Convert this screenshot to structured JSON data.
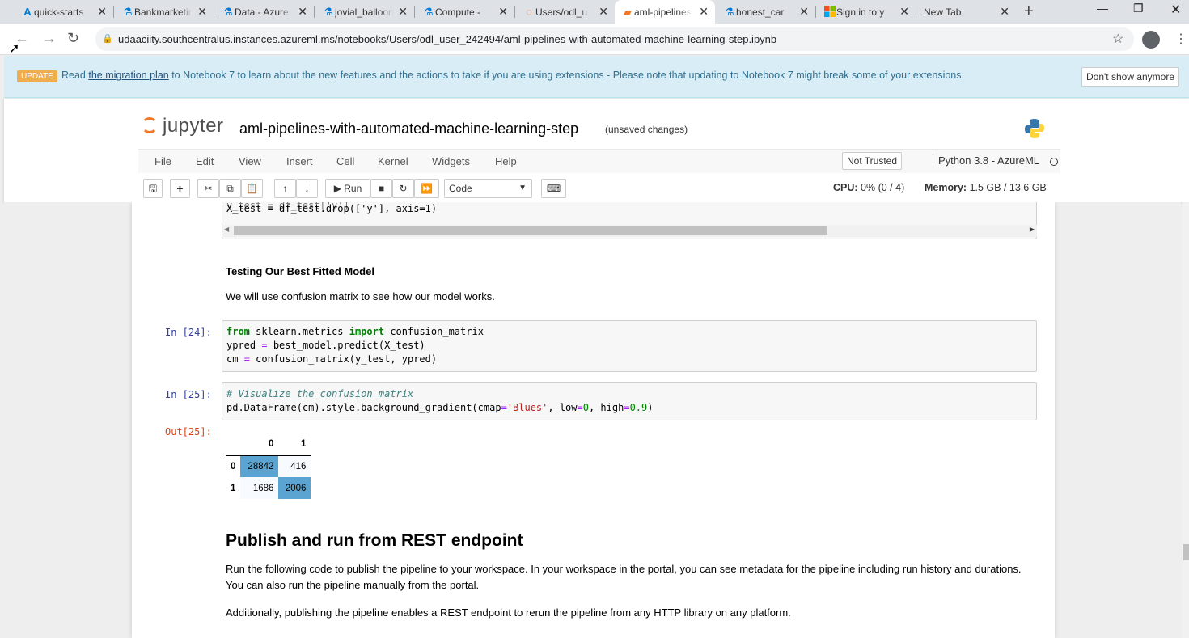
{
  "browser": {
    "tabs": [
      {
        "label": "quick-starts",
        "icon": "azure-icon"
      },
      {
        "label": "Bankmarketing",
        "icon": "azureml-icon"
      },
      {
        "label": "Data - Azure",
        "icon": "azureml-icon"
      },
      {
        "label": "jovial_balloon",
        "icon": "azureml-icon"
      },
      {
        "label": "Compute - ",
        "icon": "azureml-icon"
      },
      {
        "label": "Users/odl_u",
        "icon": "jupyter-icon"
      },
      {
        "label": "aml-pipelines",
        "icon": "notebook-icon"
      },
      {
        "label": "honest_car",
        "icon": "azureml-icon"
      },
      {
        "label": "Sign in to y",
        "icon": "microsoft-icon"
      },
      {
        "label": "New Tab",
        "icon": ""
      }
    ],
    "url": "udaaciity.southcentralus.instances.azureml.ms/notebooks/Users/odl_user_242494/aml-pipelines-with-automated-machine-learning-step.ipynb"
  },
  "banner": {
    "badge": "UPDATE",
    "text_prefix": "Read ",
    "link": "the migration plan",
    "text_suffix": " to Notebook 7 to learn about the new features and the actions to take if you are using extensions - Please note that updating to Notebook 7 might break some of your extensions.",
    "dismiss": "Don't show anymore"
  },
  "header": {
    "logo_text": "jupyter",
    "notebook_title": "aml-pipelines-with-automated-machine-learning-step",
    "save_status": "(unsaved changes)"
  },
  "menu": {
    "items": [
      "File",
      "Edit",
      "View",
      "Insert",
      "Cell",
      "Kernel",
      "Widgets",
      "Help"
    ],
    "trust": "Not Trusted",
    "kernel": "Python 3.8 - AzureML"
  },
  "toolbar": {
    "run_label": "Run",
    "cell_type": "Code",
    "cpu_label": "CPU:",
    "cpu_value": "0% (0 / 4)",
    "mem_label": "Memory:",
    "mem_value": "1.5 GB / 13.6 GB"
  },
  "cells": {
    "partial_code_line": "X_test = df_test.drop(['y'], axis=1)",
    "md_heading": "Testing Our Best Fitted Model",
    "md_text": "We will use confusion matrix to see how our model works.",
    "in24_prompt": "In [24]:",
    "in25_prompt": "In [25]:",
    "out25_prompt": "Out[25]:",
    "in25_comment": "# Visualize the confusion matrix"
  },
  "confusion_matrix": {
    "col_headers": [
      "0",
      "1"
    ],
    "rows": [
      {
        "label": "0",
        "values": [
          "28842",
          "416"
        ]
      },
      {
        "label": "1",
        "values": [
          "1686",
          "2006"
        ]
      }
    ],
    "colors": {
      "high": "#5ba3d0",
      "low": "#f7fbff"
    }
  },
  "section": {
    "title": "Publish and run from REST endpoint",
    "para1": "Run the following code to publish the pipeline to your workspace. In your workspace in the portal, you can see metadata for the pipeline including run history and durations. You can also run the pipeline manually from the portal.",
    "para2": "Additionally, publishing the pipeline enables a REST endpoint to rerun the pipeline from any HTTP library on any platform."
  }
}
